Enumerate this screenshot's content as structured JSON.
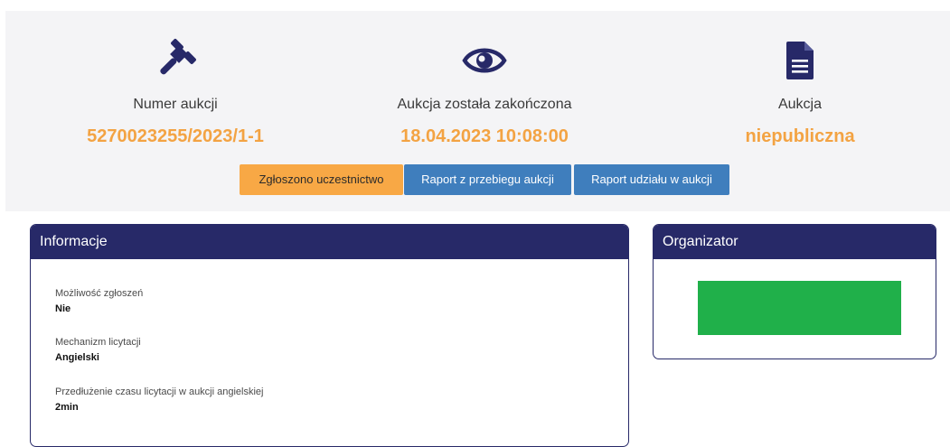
{
  "header": {
    "stats": [
      {
        "icon": "gavel-icon",
        "label": "Numer aukcji",
        "value": "5270023255/2023/1-1"
      },
      {
        "icon": "eye-icon",
        "label": "Aukcja została zakończona",
        "value": "18.04.2023 10:08:00"
      },
      {
        "icon": "document-icon",
        "label": "Aukcja",
        "value": "niepubliczna"
      }
    ],
    "buttons": {
      "participation": "Zgłoszono uczestnictwo",
      "progress_report": "Raport z przebiegu aukcji",
      "participation_report": "Raport udziału w aukcji"
    }
  },
  "info": {
    "title": "Informacje",
    "fields": [
      {
        "label": "Możliwość zgłoszeń",
        "value": "Nie"
      },
      {
        "label": "Mechanizm licytacji",
        "value": "Angielski"
      },
      {
        "label": "Przedłużenie czasu licytacji w aukcji angielskiej",
        "value": "2min"
      }
    ]
  },
  "organizer": {
    "title": "Organizator"
  },
  "colors": {
    "navy": "#272968",
    "accent_orange": "#f3a343",
    "button_blue": "#3f7ebd",
    "organizer_logo_green": "#20b04a"
  }
}
